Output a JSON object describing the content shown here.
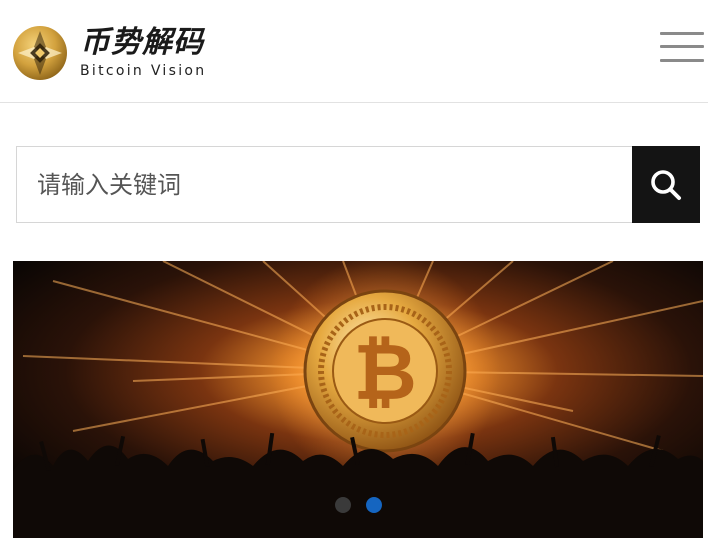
{
  "brand": {
    "name_cn": "币势解码",
    "name_en": "Bitcoin Vision",
    "logo_icon": "gold-coin-logo-icon"
  },
  "header": {
    "menu_icon": "hamburger-menu-icon"
  },
  "search": {
    "placeholder": "请输入关键词",
    "button_icon": "search-icon"
  },
  "banner": {
    "image": "bitcoin-coin-over-crowd-banner",
    "slide_count": 2,
    "active_slide": 2
  },
  "colors": {
    "search_button_bg": "#141414",
    "active_dot": "#1565c0",
    "inactive_dot": "#3a3a3a",
    "logo_gold": "#c8962e"
  }
}
